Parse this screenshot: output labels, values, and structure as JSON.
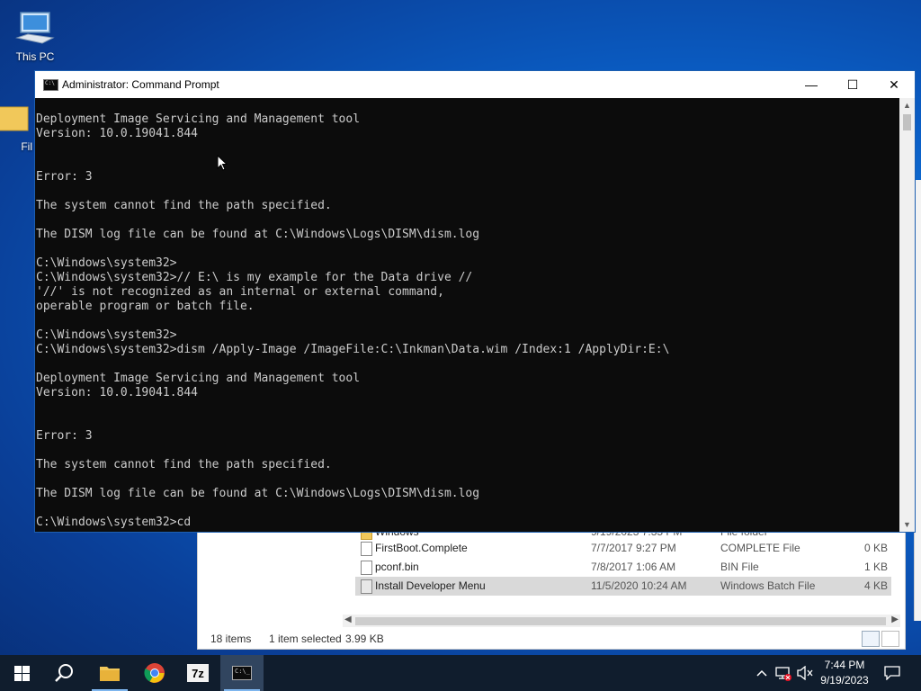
{
  "desktop": {
    "icons": [
      {
        "label": "This PC"
      },
      {
        "label": "Fil"
      }
    ]
  },
  "cmd": {
    "title": "Administrator: Command Prompt",
    "lines": [
      "",
      "Deployment Image Servicing and Management tool",
      "Version: 10.0.19041.844",
      "",
      "",
      "Error: 3",
      "",
      "The system cannot find the path specified.",
      "",
      "The DISM log file can be found at C:\\Windows\\Logs\\DISM\\dism.log",
      "",
      "C:\\Windows\\system32>",
      "C:\\Windows\\system32>// E:\\ is my example for the Data drive //",
      "'//' is not recognized as an internal or external command,",
      "operable program or batch file.",
      "",
      "C:\\Windows\\system32>",
      "C:\\Windows\\system32>dism /Apply-Image /ImageFile:C:\\Inkman\\Data.wim /Index:1 /ApplyDir:E:\\",
      "",
      "Deployment Image Servicing and Management tool",
      "Version: 10.0.19041.844",
      "",
      "",
      "Error: 3",
      "",
      "The system cannot find the path specified.",
      "",
      "The DISM log file can be found at C:\\Windows\\Logs\\DISM\\dism.log",
      "",
      "C:\\Windows\\system32>cd"
    ],
    "buttons": {
      "minimize": "—",
      "maximize": "☐",
      "close": "✕"
    }
  },
  "explorer": {
    "rows": [
      {
        "name": "Windows",
        "date": "9/19/2023 7:35 PM",
        "type": "File folder",
        "size": ""
      },
      {
        "name": "FirstBoot.Complete",
        "date": "7/7/2017 9:27 PM",
        "type": "COMPLETE File",
        "size": "0 KB"
      },
      {
        "name": "pconf.bin",
        "date": "7/8/2017 1:06 AM",
        "type": "BIN File",
        "size": "1 KB"
      },
      {
        "name": "Install Developer Menu",
        "date": "11/5/2020 10:24 AM",
        "type": "Windows Batch File",
        "size": "4 KB"
      }
    ],
    "status": {
      "item_count": "18 items",
      "selection": "1 item selected",
      "selection_size": "3.99 KB"
    }
  },
  "taskbar": {
    "apps": [
      "start",
      "search",
      "file-explorer",
      "chrome",
      "7-zip",
      "command-prompt"
    ],
    "clock_time": "7:44 PM",
    "clock_date": "9/19/2023"
  },
  "colors": {
    "taskbar": "#101d2d",
    "console_bg": "#0c0c0c",
    "console_text": "#cccccc",
    "accent": "#0a5fc7"
  }
}
